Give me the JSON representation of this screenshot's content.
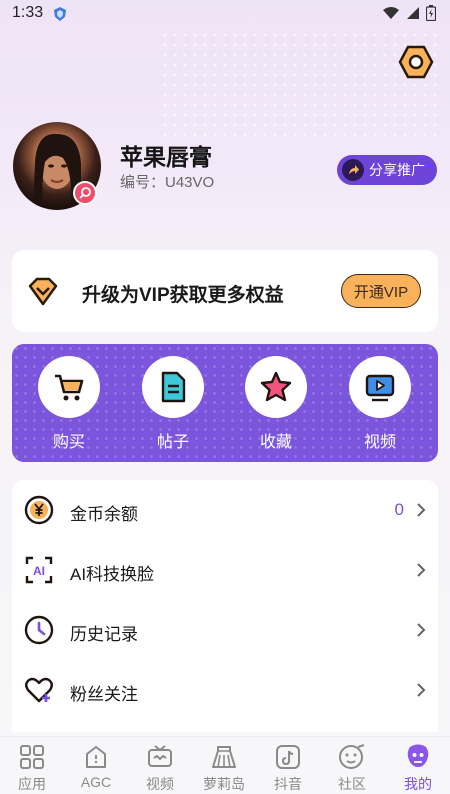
{
  "status_bar": {
    "time": "1:33"
  },
  "profile": {
    "name": "苹果唇膏",
    "id_text": "编号：U43VO",
    "share_label": "分享推广"
  },
  "vip": {
    "text": "升级为VIP获取更多权益",
    "button_label": "开通VIP"
  },
  "quick_actions": [
    {
      "label": "购买",
      "icon": "cart-icon"
    },
    {
      "label": "帖子",
      "icon": "post-document-icon"
    },
    {
      "label": "收藏",
      "icon": "star-icon"
    },
    {
      "label": "视频",
      "icon": "video-play-icon"
    }
  ],
  "menu": [
    {
      "label": "金币余额",
      "value": "0",
      "icon": "yen-coin-icon"
    },
    {
      "label": "AI科技换脸",
      "value": "",
      "icon": "ai-face-swap-icon"
    },
    {
      "label": "历史记录",
      "value": "",
      "icon": "clock-icon"
    },
    {
      "label": "粉丝关注",
      "value": "",
      "icon": "heart-plus-icon"
    }
  ],
  "tabs": [
    {
      "label": "应用",
      "icon": "apps-grid-icon",
      "active": false
    },
    {
      "label": "AGC",
      "icon": "agc-house-icon",
      "active": false
    },
    {
      "label": "视频",
      "icon": "tv-icon",
      "active": false
    },
    {
      "label": "萝莉岛",
      "icon": "skirt-icon",
      "active": false
    },
    {
      "label": "抖音",
      "icon": "tiktok-icon",
      "active": false
    },
    {
      "label": "社区",
      "icon": "community-face-icon",
      "active": false
    },
    {
      "label": "我的",
      "icon": "mine-avatar-icon",
      "active": true
    }
  ],
  "colors": {
    "accent": "#7b4fe0",
    "quick_card_bg": "#7b56dc",
    "vip_button": "#f9b25a",
    "share_button": "#6e43d8"
  }
}
